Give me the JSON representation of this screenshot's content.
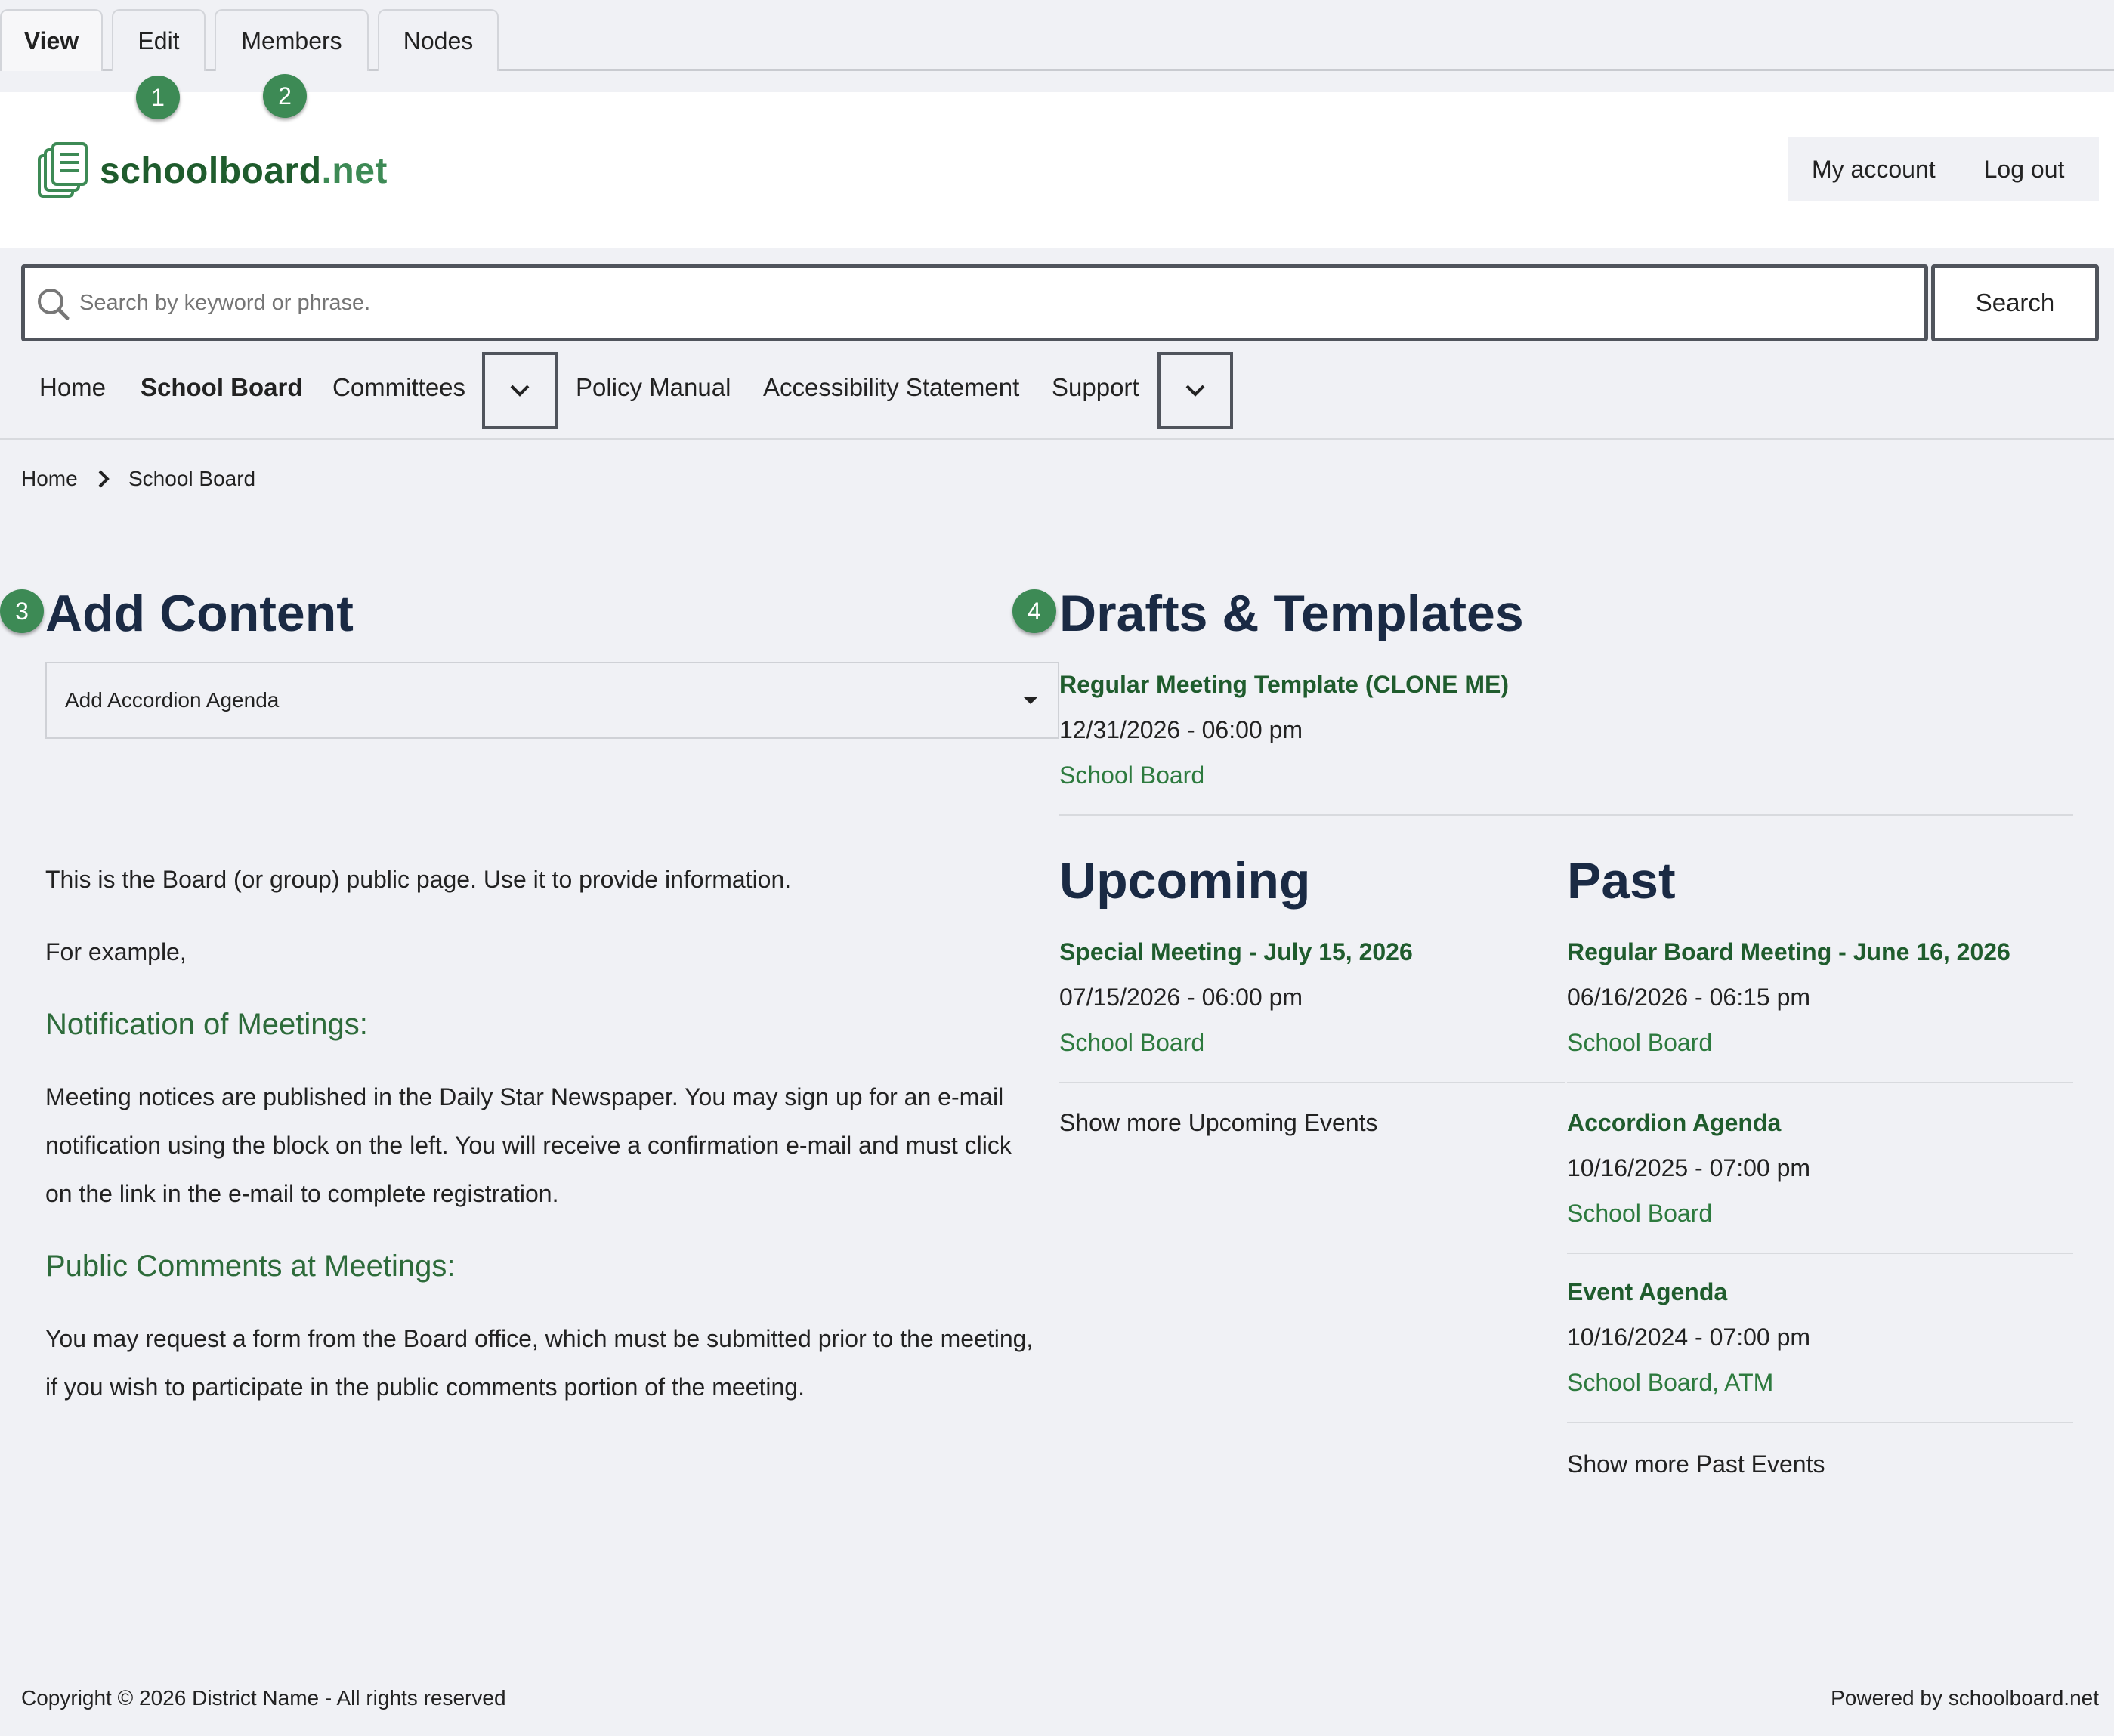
{
  "tabs": [
    {
      "label": "View"
    },
    {
      "label": "Edit"
    },
    {
      "label": "Members"
    },
    {
      "label": "Nodes"
    }
  ],
  "badges": [
    "1",
    "2",
    "3",
    "4"
  ],
  "brand": {
    "name": "schoolboard",
    "tld": ".net"
  },
  "account": {
    "my_account": "My account",
    "logout": "Log out"
  },
  "search": {
    "placeholder": "Search by keyword or phrase.",
    "button": "Search"
  },
  "nav": {
    "home": "Home",
    "school_board": "School Board",
    "committees": "Committees",
    "policy_manual": "Policy Manual",
    "accessibility": "Accessibility Statement",
    "support": "Support"
  },
  "breadcrumb": {
    "home": "Home",
    "current": "School Board"
  },
  "add_content": {
    "heading": "Add Content",
    "select_value": "Add Accordion Agenda"
  },
  "body": {
    "intro": "This is the Board (or group) public page.  Use it to provide information.",
    "example": "For example,",
    "notif_heading": "Notification of Meetings:",
    "notif_line1": "Meeting notices are published in the Daily Star Newspaper.  You may sign up for an e-mail",
    "notif_line2": "notification using the block on the left.  You will receive a confirmation e-mail and must click",
    "notif_line3": "on the link in the e-mail to complete registration.",
    "comments_heading": "Public Comments at Meetings:",
    "comments_line1": "You may request a form from the Board office, which must be submitted prior to the meeting,",
    "comments_line2": "if you wish to participate in the public comments portion of the meeting."
  },
  "drafts": {
    "heading": "Drafts & Templates",
    "item": {
      "title": "Regular Meeting Template (CLONE ME)",
      "date": "12/31/2026 - 06:00 pm",
      "group": "School Board"
    }
  },
  "upcoming": {
    "heading": "Upcoming",
    "item": {
      "title": "Special Meeting - July 15, 2026",
      "date": "07/15/2026 - 06:00 pm",
      "group": "School Board"
    },
    "more": "Show more Upcoming Events"
  },
  "past": {
    "heading": "Past",
    "items": [
      {
        "title": "Regular Board Meeting - June 16, 2026",
        "date": "06/16/2026 - 06:15 pm",
        "group": "School Board"
      },
      {
        "title": "Accordion Agenda",
        "date": "10/16/2025 - 07:00 pm",
        "group": "School Board"
      },
      {
        "title": "Event Agenda",
        "date": "10/16/2024 - 07:00 pm",
        "group": "School Board",
        "group2": "ATM"
      }
    ],
    "more": "Show more Past Events"
  },
  "footer": {
    "copyright": "Copyright © 2026 District Name - All rights reserved",
    "powered": "Powered by schoolboard.net"
  }
}
